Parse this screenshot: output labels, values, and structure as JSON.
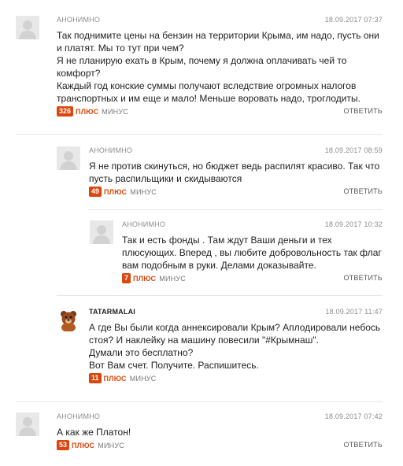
{
  "ui": {
    "plus_label": "ПЛЮС",
    "minus_label": "МИНУС",
    "reply_label": "ОТВЕТИТЬ"
  },
  "comments": [
    {
      "author": "АНОНИМНО",
      "date": "18.09.2017 07:37",
      "text": "Так поднимите цены на бензин на территории Крыма, им надо, пусть они и платят. Мы то тут при чем?\nЯ не планирую ехать в Крым, почему я должна оплачивать чей то комфорт?\nКаждый год конские суммы получают вследствие огромных налогов транспортных и им еще и мало! Меньше воровать надо, троглодиты.",
      "votes": "326"
    },
    {
      "author": "АНОНИМНО",
      "date": "18.09.2017 08:59",
      "text": "Я не против скинуться, но бюджет ведь распилят красиво. Так что пусть распильщики и скидываются",
      "votes": "49"
    },
    {
      "author": "АНОНИМНО",
      "date": "18.09.2017 10:32",
      "text": "Так и есть фонды . Там ждут Ваши деньги и тех плюсующих. Вперед , вы любите добровольность так флаг вам подобным в руки. Делами доказывайте.",
      "votes": "7"
    },
    {
      "author": "TATARMALAI",
      "date": "18.09.2017 11:47",
      "text": "А где Вы были когда аннексировали Крым? Аплодировали небось стоя? И наклейку на машину повесили \"#Крымнаш\".\nДумали это бесплатно?\nВот Вам счет. Получите. Распишитесь.",
      "votes": "11"
    },
    {
      "author": "АНОНИМНО",
      "date": "18.09.2017 07:42",
      "text": "А как же Платон!",
      "votes": "53"
    }
  ]
}
